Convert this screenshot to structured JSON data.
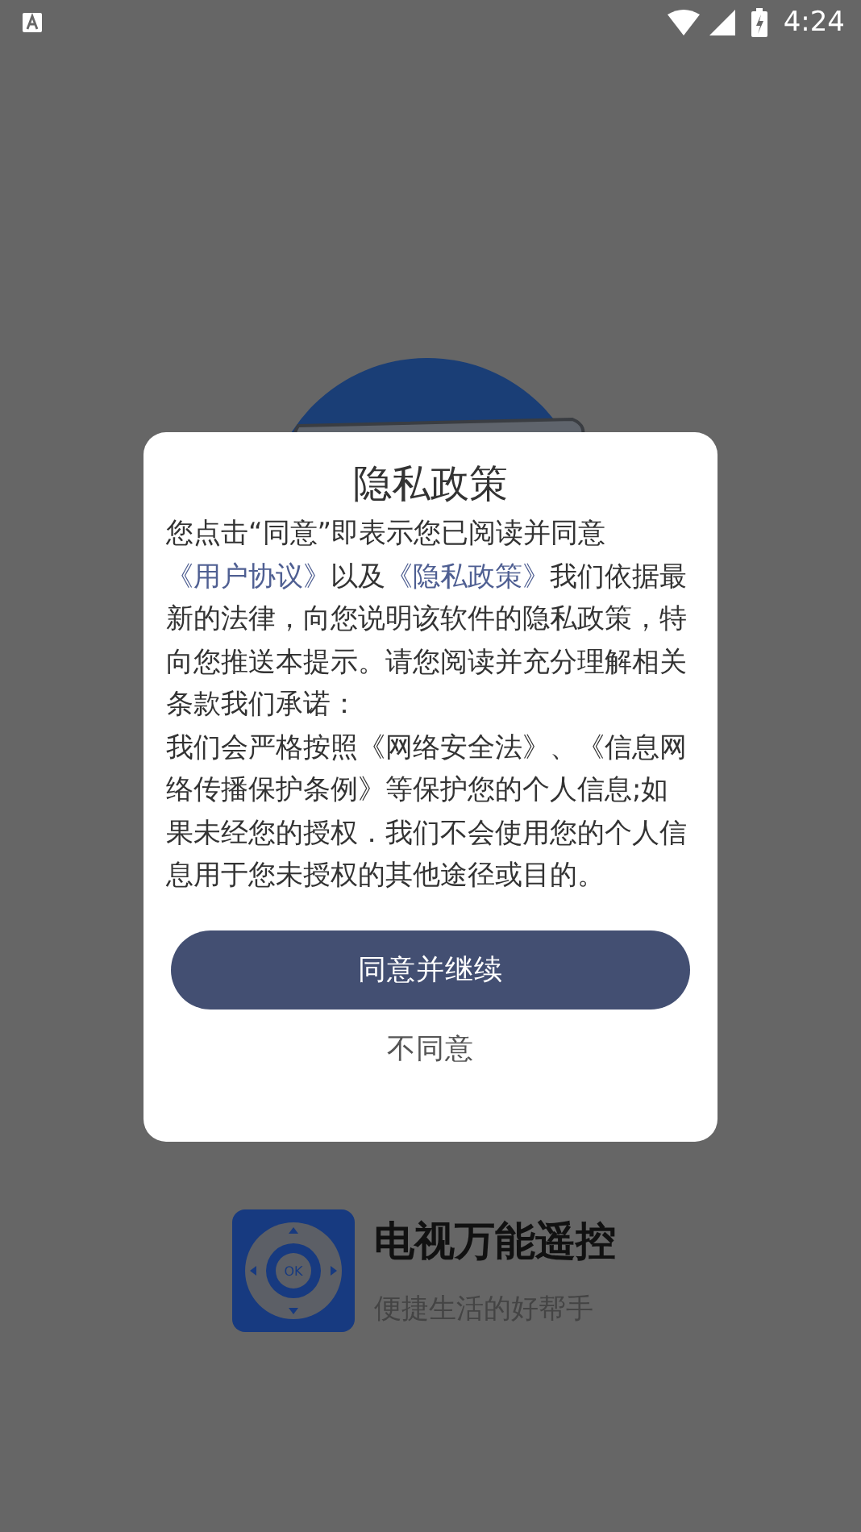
{
  "status_bar": {
    "time": "4:24"
  },
  "app": {
    "icon_text": "OK",
    "name": "电视万能遥控",
    "slogan": "便捷生活的好帮手"
  },
  "dialog": {
    "title": "隐私政策",
    "body": [
      {
        "kind": "text",
        "text": "您点击“同意”即表示您已阅读并同意"
      },
      {
        "kind": "link",
        "text": "《用户协议》"
      },
      {
        "kind": "text",
        "text": "以及"
      },
      {
        "kind": "link",
        "text": "《隐私政策》"
      },
      {
        "kind": "text",
        "text": "我们依据最新的法律，向您说明该软件的隐私政策，特向您推送本提示。请您阅读并充分理解相关条款我们承诺："
      },
      {
        "kind": "break"
      },
      {
        "kind": "text",
        "text": "我们会严格按照《网络安全法》、《信息网络传播保护条例》等保护您的个人信息;如果未经您的授权．我们不会使用您的个人信息用于您未授权的其他途径或目的。"
      }
    ],
    "buttons": [
      {
        "kind": "primary",
        "label": "同意并继续"
      },
      {
        "kind": "plain",
        "label": "不同意"
      }
    ]
  }
}
